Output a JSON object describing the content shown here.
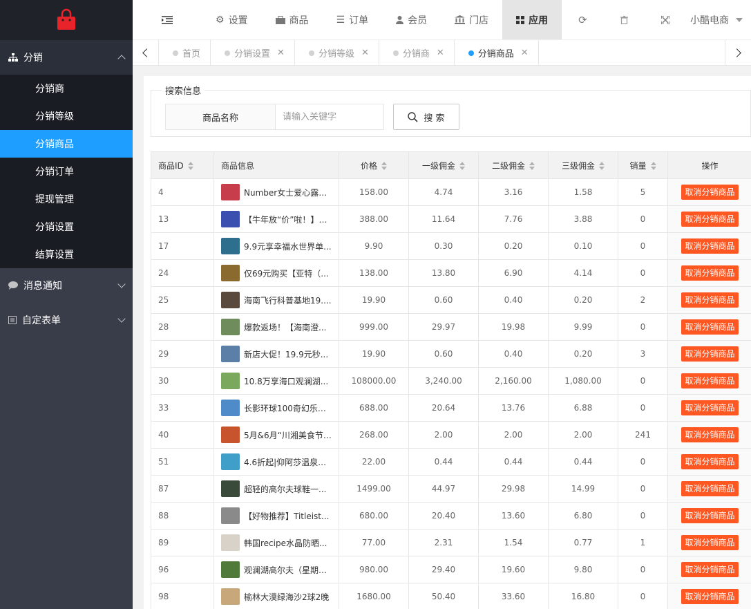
{
  "sidebar": {
    "groups": [
      {
        "label": "分销",
        "icon": "sitemap-icon",
        "open": true,
        "items": [
          "分销商",
          "分销等级",
          "分销商品",
          "分销订单",
          "提现管理",
          "分销设置",
          "结算设置"
        ],
        "active_index": 2
      },
      {
        "label": "消息通知",
        "icon": "chat-icon"
      },
      {
        "label": "自定表单",
        "icon": "form-icon"
      }
    ]
  },
  "header": {
    "nav": [
      {
        "label": "设置",
        "icon": "gears-icon"
      },
      {
        "label": "商品",
        "icon": "briefcase-icon"
      },
      {
        "label": "订单",
        "icon": "list-icon"
      },
      {
        "label": "会员",
        "icon": "user-icon"
      },
      {
        "label": "门店",
        "icon": "bank-icon"
      },
      {
        "label": "应用",
        "icon": "grid-icon",
        "active": true
      }
    ],
    "user": "小酷电商"
  },
  "tabs": [
    {
      "label": "首页",
      "closable": false
    },
    {
      "label": "分销设置",
      "closable": true
    },
    {
      "label": "分销等级",
      "closable": true
    },
    {
      "label": "分销商",
      "closable": true
    },
    {
      "label": "分销商品",
      "closable": true,
      "active": true
    }
  ],
  "search": {
    "legend": "搜索信息",
    "field_label": "商品名称",
    "placeholder": "请输入关键字",
    "button": "搜 索"
  },
  "table": {
    "headers": [
      "商品ID",
      "商品信息",
      "价格",
      "一级佣金",
      "二级佣金",
      "三级佣金",
      "销量",
      "操作"
    ],
    "action_label": "取消分销商品",
    "rows": [
      {
        "id": "4",
        "name": "Number女士爱心露指...",
        "price": "158.00",
        "c1": "4.74",
        "c2": "3.16",
        "c3": "1.58",
        "sales": "5",
        "thumb": "#c83d4b"
      },
      {
        "id": "13",
        "name": "【牛年放“价”啦！】3...",
        "price": "388.00",
        "c1": "11.64",
        "c2": "7.76",
        "c3": "3.88",
        "sales": "0",
        "thumb": "#3a4fb0"
      },
      {
        "id": "17",
        "name": "9.9元享幸福水世界单...",
        "price": "9.90",
        "c1": "0.30",
        "c2": "0.20",
        "c3": "0.10",
        "sales": "0",
        "thumb": "#2e6f8e"
      },
      {
        "id": "24",
        "name": "仅69元购买【亚特（...",
        "price": "138.00",
        "c1": "13.80",
        "c2": "6.90",
        "c3": "4.14",
        "sales": "0",
        "thumb": "#8a6a2e"
      },
      {
        "id": "25",
        "name": "海南飞行科普基地19....",
        "price": "19.90",
        "c1": "0.60",
        "c2": "0.40",
        "c3": "0.20",
        "sales": "2",
        "thumb": "#5a4a3e"
      },
      {
        "id": "28",
        "name": "爆款返场！【海南澄...",
        "price": "999.00",
        "c1": "29.97",
        "c2": "19.98",
        "c3": "9.99",
        "sales": "0",
        "thumb": "#6f8d5c"
      },
      {
        "id": "29",
        "name": "新店大促！19.9元秒...",
        "price": "19.90",
        "c1": "0.60",
        "c2": "0.40",
        "c3": "0.20",
        "sales": "3",
        "thumb": "#5c7fa8"
      },
      {
        "id": "30",
        "name": "10.8万享海口观澜湖...",
        "price": "108000.00",
        "c1": "3,240.00",
        "c2": "2,160.00",
        "c3": "1,080.00",
        "sales": "0",
        "thumb": "#7aa85c"
      },
      {
        "id": "33",
        "name": "长影环球100奇幻乐园...",
        "price": "688.00",
        "c1": "20.64",
        "c2": "13.76",
        "c3": "6.88",
        "sales": "0",
        "thumb": "#4f8bc8"
      },
      {
        "id": "40",
        "name": "5月&6月“川湘美食节”...",
        "price": "268.00",
        "c1": "2.00",
        "c2": "2.00",
        "c3": "2.00",
        "sales": "241",
        "thumb": "#c8542e"
      },
      {
        "id": "51",
        "name": "4.6折起|仰阿莎温泉小...",
        "price": "22.00",
        "c1": "0.44",
        "c2": "0.44",
        "c3": "0.44",
        "sales": "0",
        "thumb": "#3f9fc8"
      },
      {
        "id": "87",
        "name": "超轻的高尔夫球鞋一...",
        "price": "1499.00",
        "c1": "44.97",
        "c2": "29.98",
        "c3": "14.99",
        "sales": "0",
        "thumb": "#3a4a3a"
      },
      {
        "id": "88",
        "name": "【好物推荐】Titleist...",
        "price": "680.00",
        "c1": "20.40",
        "c2": "13.60",
        "c3": "6.80",
        "sales": "0",
        "thumb": "#8a8a8a"
      },
      {
        "id": "89",
        "name": "韩国recipe水晶防晒...",
        "price": "77.00",
        "c1": "2.31",
        "c2": "1.54",
        "c3": "0.77",
        "sales": "1",
        "thumb": "#d8d2c8"
      },
      {
        "id": "96",
        "name": "观澜湖高尔夫（星期+...",
        "price": "980.00",
        "c1": "29.40",
        "c2": "19.60",
        "c3": "9.80",
        "sales": "0",
        "thumb": "#4f7a3a"
      },
      {
        "id": "98",
        "name": "榆林大漠绿海沙2球2晚",
        "price": "1680.00",
        "c1": "50.40",
        "c2": "33.60",
        "c3": "16.80",
        "sales": "0",
        "thumb": "#c8a87a"
      }
    ]
  },
  "colors": {
    "accent": "#1e9fff",
    "danger": "#ff5722",
    "sidebar": "#393d49"
  }
}
